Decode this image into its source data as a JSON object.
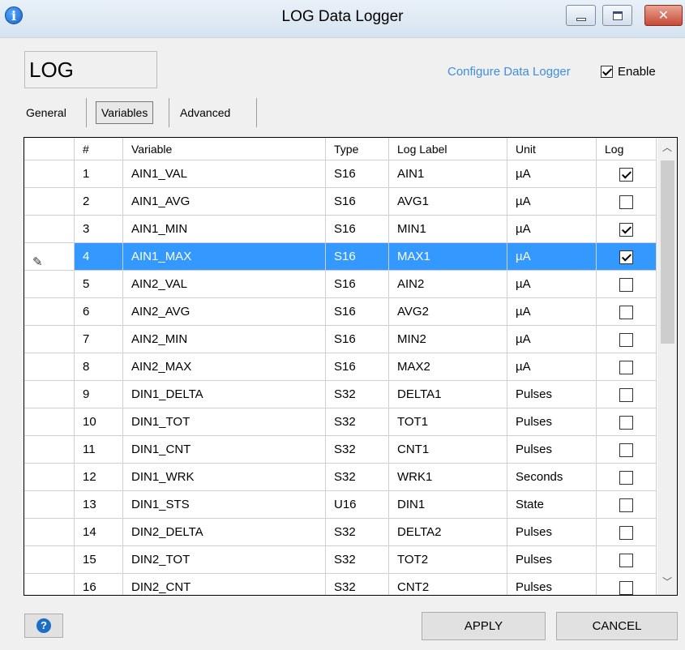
{
  "window": {
    "title": "LOG Data Logger",
    "icon": "info-icon"
  },
  "header": {
    "name": "LOG",
    "configure_link": "Configure Data Logger",
    "enable_label": "Enable",
    "enable_checked": true
  },
  "tabs": [
    {
      "label": "General",
      "active": false
    },
    {
      "label": "Variables",
      "active": true
    },
    {
      "label": "Advanced",
      "active": false
    }
  ],
  "grid": {
    "columns": [
      "#",
      "Variable",
      "Type",
      "Log Label",
      "Unit",
      "Log"
    ],
    "selected_index": 4,
    "rows": [
      {
        "num": "1",
        "variable": "AIN1_VAL",
        "type": "S16",
        "label": "AIN1",
        "unit": "µA",
        "log": true
      },
      {
        "num": "2",
        "variable": "AIN1_AVG",
        "type": "S16",
        "label": "AVG1",
        "unit": "µA",
        "log": false
      },
      {
        "num": "3",
        "variable": "AIN1_MIN",
        "type": "S16",
        "label": "MIN1",
        "unit": "µA",
        "log": true
      },
      {
        "num": "4",
        "variable": "AIN1_MAX",
        "type": "S16",
        "label": "MAX1",
        "unit": "µA",
        "log": true
      },
      {
        "num": "5",
        "variable": "AIN2_VAL",
        "type": "S16",
        "label": "AIN2",
        "unit": "µA",
        "log": false
      },
      {
        "num": "6",
        "variable": "AIN2_AVG",
        "type": "S16",
        "label": "AVG2",
        "unit": "µA",
        "log": false
      },
      {
        "num": "7",
        "variable": "AIN2_MIN",
        "type": "S16",
        "label": "MIN2",
        "unit": "µA",
        "log": false
      },
      {
        "num": "8",
        "variable": "AIN2_MAX",
        "type": "S16",
        "label": "MAX2",
        "unit": "µA",
        "log": false
      },
      {
        "num": "9",
        "variable": "DIN1_DELTA",
        "type": "S32",
        "label": "DELTA1",
        "unit": "Pulses",
        "log": false
      },
      {
        "num": "10",
        "variable": "DIN1_TOT",
        "type": "S32",
        "label": "TOT1",
        "unit": "Pulses",
        "log": false
      },
      {
        "num": "11",
        "variable": "DIN1_CNT",
        "type": "S32",
        "label": "CNT1",
        "unit": "Pulses",
        "log": false
      },
      {
        "num": "12",
        "variable": "DIN1_WRK",
        "type": "S32",
        "label": "WRK1",
        "unit": "Seconds",
        "log": false
      },
      {
        "num": "13",
        "variable": "DIN1_STS",
        "type": "U16",
        "label": "DIN1",
        "unit": "State",
        "log": false
      },
      {
        "num": "14",
        "variable": "DIN2_DELTA",
        "type": "S32",
        "label": "DELTA2",
        "unit": "Pulses",
        "log": false
      },
      {
        "num": "15",
        "variable": "DIN2_TOT",
        "type": "S32",
        "label": "TOT2",
        "unit": "Pulses",
        "log": false
      },
      {
        "num": "16",
        "variable": "DIN2_CNT",
        "type": "S32",
        "label": "CNT2",
        "unit": "Pulses",
        "log": false
      }
    ]
  },
  "footer": {
    "help_icon": "help-icon",
    "apply_label": "APPLY",
    "cancel_label": "CANCEL"
  },
  "colors": {
    "selection": "#3399ff",
    "link": "#3e8ede"
  }
}
